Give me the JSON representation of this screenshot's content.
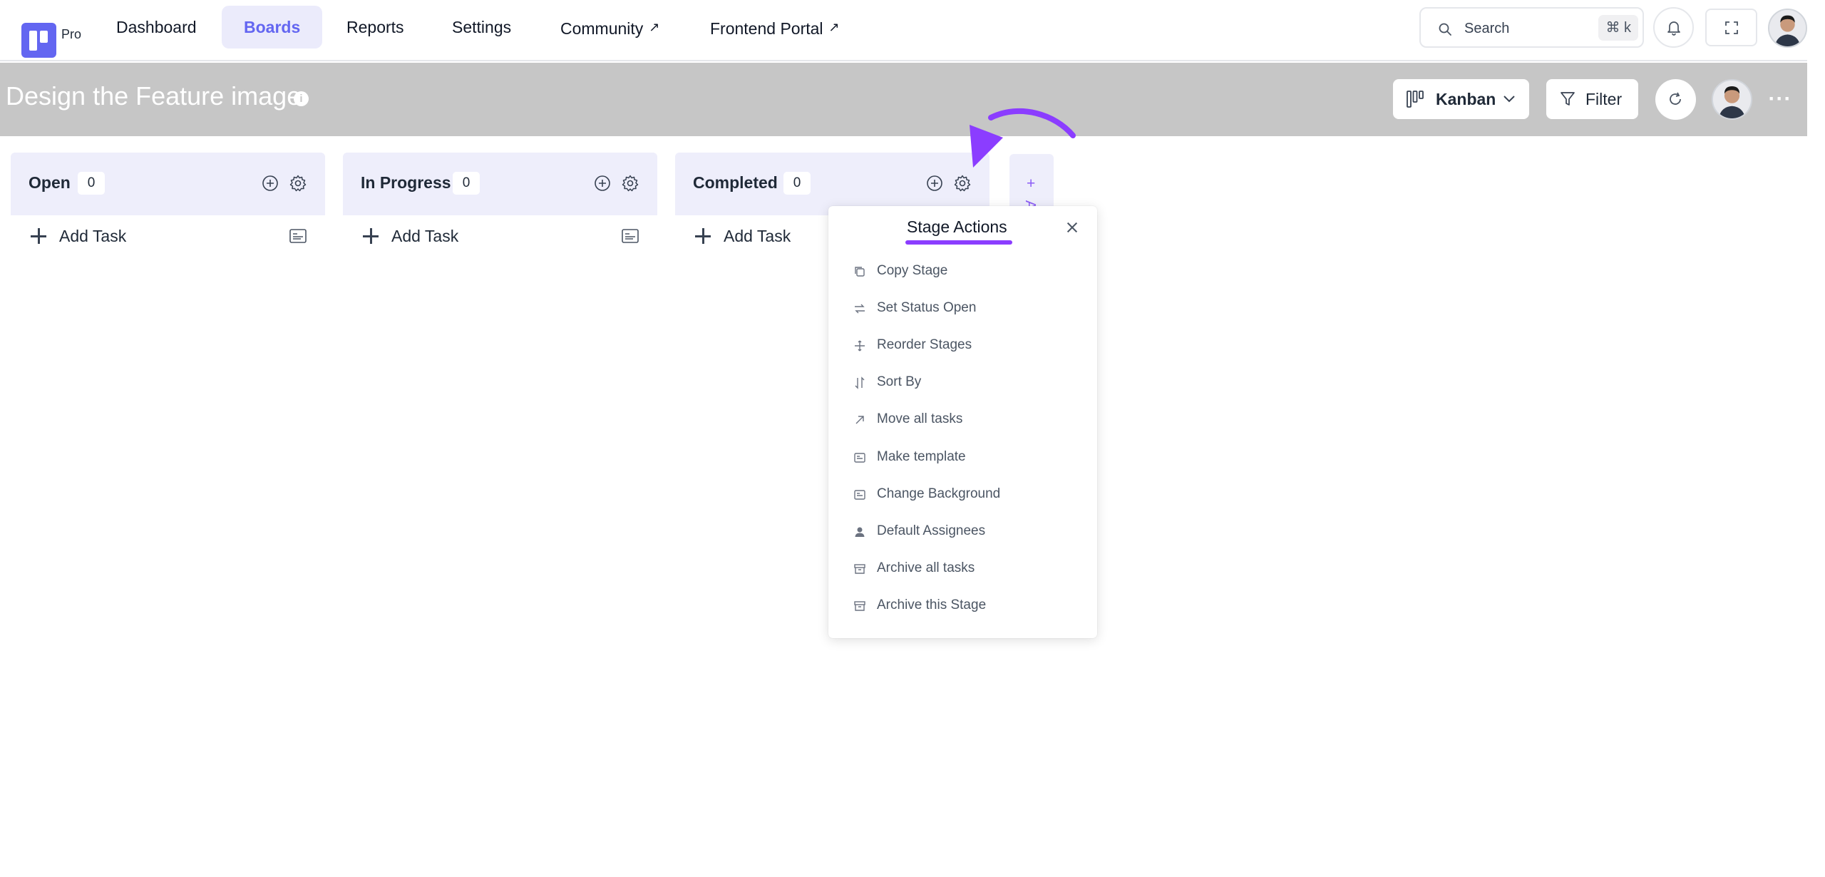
{
  "app": {
    "pro_label": "Pro",
    "accent_color": "#6366f1"
  },
  "nav": {
    "items": [
      {
        "label": "Dashboard",
        "external": false
      },
      {
        "label": "Boards",
        "external": false,
        "active": true
      },
      {
        "label": "Reports",
        "external": false
      },
      {
        "label": "Settings",
        "external": false
      },
      {
        "label": "Community",
        "external": true
      },
      {
        "label": "Frontend Portal",
        "external": true
      }
    ],
    "search": {
      "placeholder": "Search",
      "shortcut": "⌘ k"
    },
    "external_glyph": "↗"
  },
  "board": {
    "title": "Design the Feature image",
    "info_glyph": "i",
    "view_label": "Kanban",
    "filter_label": "Filter",
    "more_glyph": "···"
  },
  "stages": [
    {
      "name": "Open",
      "count": "0",
      "add_task_label": "Add Task"
    },
    {
      "name": "In Progress",
      "count": "0",
      "add_task_label": "Add Task"
    },
    {
      "name": "Completed",
      "count": "0",
      "add_task_label": "Add Task"
    }
  ],
  "add_stage": {
    "plus": "+",
    "text": "A"
  },
  "stage_actions": {
    "title": "Stage Actions",
    "underline_color": "#8b3dff",
    "items": [
      {
        "label": "Copy Stage",
        "icon": "copy-icon"
      },
      {
        "label": "Set Status Open",
        "icon": "status-icon"
      },
      {
        "label": "Reorder Stages",
        "icon": "move-icon"
      },
      {
        "label": "Sort By",
        "icon": "sort-icon"
      },
      {
        "label": "Move all tasks",
        "icon": "arrow-up-right-icon"
      },
      {
        "label": "Make template",
        "icon": "template-icon"
      },
      {
        "label": "Change Background",
        "icon": "background-icon"
      },
      {
        "label": "Default Assignees",
        "icon": "user-icon"
      },
      {
        "label": "Archive all tasks",
        "icon": "archive-icon"
      },
      {
        "label": "Archive this Stage",
        "icon": "archive-icon"
      }
    ]
  }
}
